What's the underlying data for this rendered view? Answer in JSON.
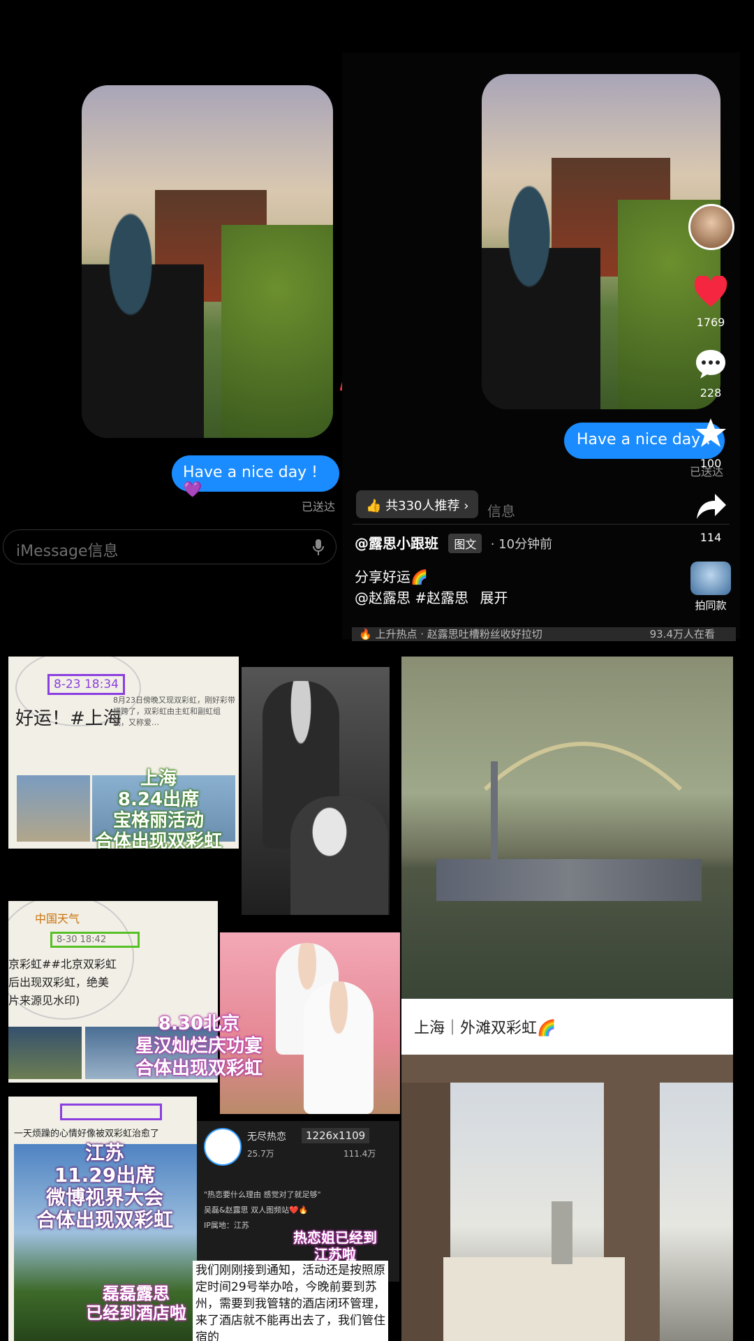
{
  "left_chat": {
    "bubble_text": "Have a nice day !",
    "bubble_emoji": "💜",
    "status": "已送达",
    "input_placeholder": "iMessage信息",
    "mic_icon": "mic-icon"
  },
  "right_post": {
    "bubble_text": "Have a nice day !",
    "status": "已送达",
    "likes": "1769",
    "comments": "228",
    "favorites": "100",
    "shares": "114",
    "recommend": "共330人推荐",
    "input_placeholder": "信息",
    "author": "@露思小跟班",
    "type_badge": "图文",
    "time": "· 10分钟前",
    "caption": "分享好运🌈",
    "tags": "@赵露思 #赵露思",
    "expand": "展开",
    "same_style": "拍同款",
    "hot_bar": "上升热点 · 赵露思吐槽粉丝收好拉切",
    "hot_count": "93.4万人在看"
  },
  "collage": {
    "stamp1": "8-23 18:34",
    "text1_big": "好运！#上海",
    "text1_small": "8月23日傍晚又现双彩虹，刚好彩带横跨了，双彩虹由主虹和副虹组成，又称爱…",
    "label1": [
      "上海",
      "8.24出席",
      "宝格丽活动",
      "合体出现双彩虹"
    ],
    "weather_account": "中国天气",
    "stamp2": "8-30 18:42",
    "text2_lines": [
      "京彩虹##北京双彩虹",
      "后出现双彩虹，绝美",
      "片来源见水印)"
    ],
    "label2": [
      "8.30北京",
      "星汉灿烂庆功宴",
      "合体出现双彩虹"
    ],
    "text3": "一天烦躁的心情好像被双彩虹治愈了",
    "label3": [
      "江苏",
      "11.29出席",
      "微博视界大会",
      "合体出现双彩虹"
    ],
    "label3b": [
      "磊磊露思",
      "已经到酒店啦"
    ],
    "account_name": "无尽热恋",
    "dims": "1226x1109",
    "fans": "25.7万",
    "likes_count": "111.4万",
    "chat_lines": [
      "\"热恋要什么理由 感觉对了就足够\"",
      "吴磊&赵露思 双人图频站❤️🔥",
      "IP属地：江苏"
    ],
    "overlay_pink": [
      "热恋姐已经到",
      "江苏啦"
    ],
    "notice": "我们刚刚接到通知，活动还是按照原定时间29号举办哈，今晚前要到苏州，需要到我管辖的酒店闭环管理，来了酒店就不能再出去了，我们管住宿的",
    "bund_caption": "上海｜外滩双彩虹🌈"
  },
  "icons": {
    "heart": "heart-icon",
    "comment": "comment-icon",
    "star": "star-icon",
    "share": "share-icon",
    "thumb": "thumb-up-icon",
    "rainbow": "rainbow-sticker"
  }
}
